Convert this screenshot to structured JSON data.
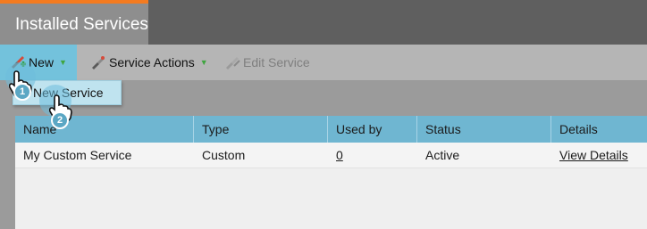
{
  "header": {
    "active_tab": "Installed Services"
  },
  "toolbar": {
    "new_label": "New",
    "service_actions_label": "Service Actions",
    "edit_service_label": "Edit Service"
  },
  "dropdown": {
    "items": [
      {
        "label": "New Service"
      }
    ]
  },
  "grid": {
    "columns": [
      "Name",
      "Type",
      "Used by",
      "Status",
      "Details"
    ],
    "rows": [
      {
        "name": "My Custom Service",
        "type": "Custom",
        "used_by": "0",
        "status": "Active",
        "details": "View Details"
      }
    ]
  },
  "callouts": {
    "step1": "1",
    "step2": "2"
  },
  "colors": {
    "accent_orange": "#f47b20",
    "header_blue": "#6fb6d1",
    "highlight_blue": "#73c2dc"
  },
  "icons": [
    "new-service-icon",
    "service-actions-icon",
    "edit-service-icon",
    "hand-cursor-icon"
  ]
}
